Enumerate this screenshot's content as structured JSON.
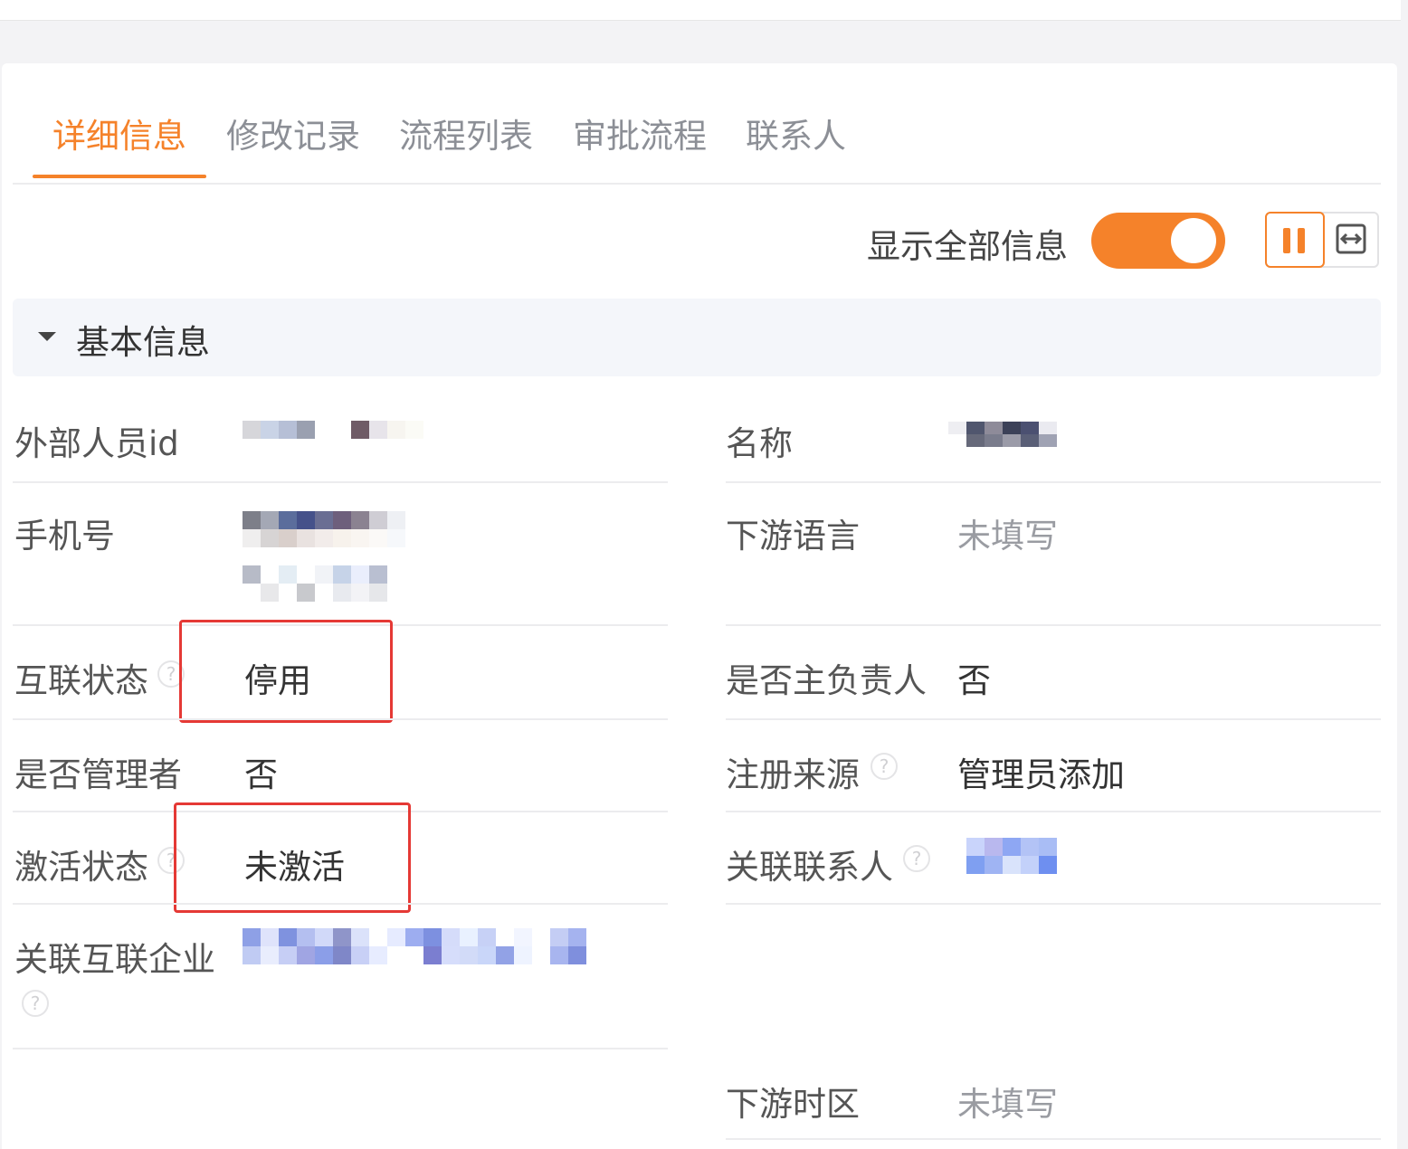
{
  "tabs": [
    {
      "label": "详细信息",
      "active": true
    },
    {
      "label": "修改记录",
      "active": false
    },
    {
      "label": "流程列表",
      "active": false
    },
    {
      "label": "审批流程",
      "active": false
    },
    {
      "label": "联系人",
      "active": false
    }
  ],
  "toolbar": {
    "show_all_label": "显示全部信息",
    "show_all_enabled": true
  },
  "section": {
    "title": "基本信息"
  },
  "fields": {
    "external_id": {
      "label": "外部人员id"
    },
    "name": {
      "label": "名称"
    },
    "phone": {
      "label": "手机号"
    },
    "downstream_language": {
      "label": "下游语言",
      "value": "未填写"
    },
    "interconnect_status": {
      "label": "互联状态",
      "value": "停用"
    },
    "is_primary_owner": {
      "label": "是否主负责人",
      "value": "否"
    },
    "is_admin": {
      "label": "是否管理者",
      "value": "否"
    },
    "registration_source": {
      "label": "注册来源",
      "value": "管理员添加"
    },
    "activation_status": {
      "label": "激活状态",
      "value": "未激活"
    },
    "linked_contact": {
      "label": "关联联系人"
    },
    "linked_enterprise": {
      "label": "关联互联企业"
    },
    "downstream_timezone": {
      "label": "下游时区",
      "value": "未填写"
    }
  },
  "help_glyph": "?",
  "colors": {
    "accent": "#f5822a",
    "highlight_box": "#e53935",
    "label": "#555555",
    "empty_value": "#9a9ca2"
  },
  "icons": {
    "section_toggle": "caret-down-icon",
    "layout_two_column": "two-column-icon",
    "layout_full_width": "expand-width-icon",
    "help": "question-circle-icon"
  }
}
